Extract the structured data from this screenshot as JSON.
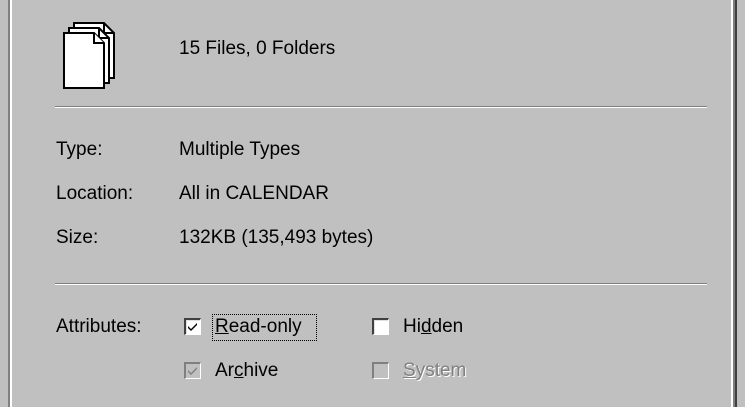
{
  "summary": {
    "file_count_text": "15 Files, 0 Folders",
    "icon": "multiple-files-icon"
  },
  "properties": {
    "type_label": "Type:",
    "type_value": "Multiple Types",
    "location_label": "Location:",
    "location_value": "All in CALENDAR",
    "size_label": "Size:",
    "size_value": "132KB (135,493 bytes)"
  },
  "attributes": {
    "label": "Attributes:",
    "read_only": {
      "label": "Read-only",
      "mnemonic": "R",
      "checked": true,
      "enabled": true,
      "focused": true
    },
    "hidden": {
      "label": "Hidden",
      "mnemonic": "d",
      "checked": false,
      "enabled": true
    },
    "archive": {
      "label": "Archive",
      "mnemonic": "c",
      "checked": true,
      "enabled": false
    },
    "system": {
      "label": "System",
      "mnemonic": "S",
      "checked": false,
      "enabled": false
    }
  },
  "colors": {
    "face": "#c0c0c0",
    "shadow": "#808080",
    "highlight": "#ffffff",
    "text": "#000000"
  }
}
